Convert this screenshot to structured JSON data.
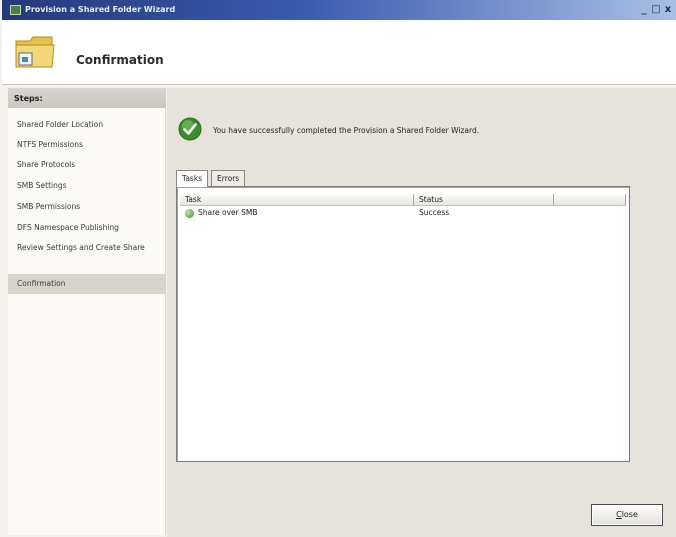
{
  "window": {
    "title": "Provision a Shared Folder Wizard",
    "minimize": "_",
    "maximize": "□",
    "close": "x"
  },
  "header": {
    "title": "Confirmation"
  },
  "steps": {
    "heading": "Steps:",
    "items": [
      {
        "label": "Shared Folder Location"
      },
      {
        "label": "NTFS Permissions"
      },
      {
        "label": "Share Protocols"
      },
      {
        "label": "SMB Settings"
      },
      {
        "label": "SMB Permissions"
      },
      {
        "label": "DFS Namespace Publishing"
      },
      {
        "label": "Review Settings and Create Share"
      },
      {
        "label": "Confirmation"
      }
    ]
  },
  "main": {
    "message": "You have successfully completed the Provision a Shared Folder Wizard.",
    "tabs": [
      {
        "label": "Tasks"
      },
      {
        "label": "Errors"
      }
    ],
    "columns": [
      "Task",
      "Status"
    ],
    "rows": [
      {
        "task": "Share over SMB",
        "status": "Success"
      }
    ]
  },
  "footer": {
    "close_label": "lose",
    "close_accel": "C"
  },
  "colors": {
    "titlebar": "#24397c",
    "success": "#3a8e2b"
  }
}
